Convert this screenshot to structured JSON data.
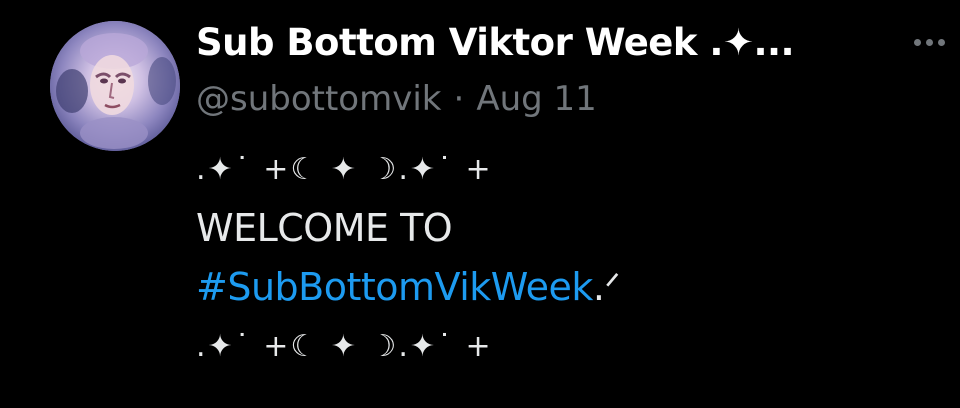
{
  "tweet": {
    "display_name": "Sub Bottom Viktor Week .✦...",
    "handle": "@subottomvik",
    "separator": "·",
    "date": "Aug 11",
    "more_icon": "more-horizontal-icon",
    "avatar_icon": "profile-avatar",
    "body": {
      "line1": ".✦˙ +☾ ✦ ☽.✦˙ +",
      "line2": "WELCOME TO",
      "hashtag": "#SubBottomVikWeek",
      "hashtag_suffix": ".ᐟ",
      "line4": ".✦˙ +☾ ✦ ☽.✦˙ +"
    }
  },
  "colors": {
    "background": "#000000",
    "name": "#ffffff",
    "muted": "#71767b",
    "text": "#e7e9ea",
    "link": "#1d9bf0"
  }
}
